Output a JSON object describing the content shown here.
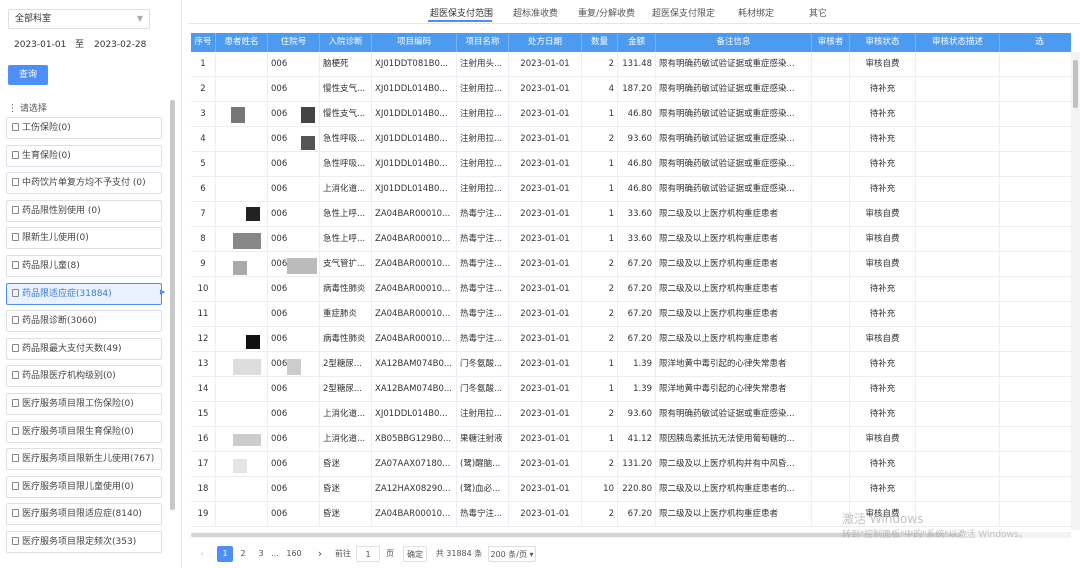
{
  "sidebar": {
    "department_select": "全部科室",
    "date_from": "2023-01-01",
    "date_sep": "至",
    "date_to": "2023-02-28",
    "query_label": "查询",
    "filter_title": "请选择",
    "filters": [
      {
        "label": "工伤保险(0)"
      },
      {
        "label": "生育保险(0)"
      },
      {
        "label": "中药饮片单复方均不予支付 (0)"
      },
      {
        "label": "药品限性别使用 (0)"
      },
      {
        "label": "限新生儿使用(0)"
      },
      {
        "label": "药品限儿童(8)"
      },
      {
        "label": "药品限适应症(31884)",
        "active": true
      },
      {
        "label": "药品限诊断(3060)"
      },
      {
        "label": "药品限最大支付天数(49)"
      },
      {
        "label": "药品限医疗机构级别(0)"
      },
      {
        "label": "医疗服务项目限工伤保险(0)"
      },
      {
        "label": "医疗服务项目限生育保险(0)"
      },
      {
        "label": "医疗服务项目限新生儿使用(767)"
      },
      {
        "label": "医疗服务项目限儿童使用(0)"
      },
      {
        "label": "医疗服务项目限适应症(8140)"
      },
      {
        "label": "医疗服务项目限定频次(353)"
      }
    ]
  },
  "tabs": [
    {
      "label": "超医保支付范围",
      "active": true
    },
    {
      "label": "超标准收费"
    },
    {
      "label": "重复/分解收费"
    },
    {
      "label": "超医保支付限定"
    },
    {
      "label": "耗材绑定"
    },
    {
      "label": "其它"
    }
  ],
  "table": {
    "headers": [
      "序号",
      "患者姓名",
      "住院号",
      "入院诊断",
      "项目编码",
      "项目名称",
      "处方日期",
      "数量",
      "金额",
      "备注信息",
      "审核者",
      "审核状态",
      "审核状态描述",
      "选"
    ],
    "rows": [
      {
        "no": "1",
        "zy": "006",
        "diag": "脑梗死",
        "code": "XJ01DDT081B0...",
        "name": "注射用头...",
        "date": "2023-01-01",
        "qty": "2",
        "amt": "131.48",
        "note": "限有明确药敏试验证据或重症感染...",
        "status": "审核自费"
      },
      {
        "no": "2",
        "zy": "006",
        "diag": "慢性支气...",
        "code": "XJ01DDL014B0...",
        "name": "注射用拉...",
        "date": "2023-01-01",
        "qty": "4",
        "amt": "187.20",
        "note": "限有明确药敏试验证据或重症感染...",
        "status": "待补充"
      },
      {
        "no": "3",
        "zy": "006",
        "diag": "慢性支气...",
        "code": "XJ01DDL014B0...",
        "name": "注射用拉...",
        "date": "2023-01-01",
        "qty": "1",
        "amt": "46.80",
        "note": "限有明确药敏试验证据或重症感染...",
        "status": "待补充"
      },
      {
        "no": "4",
        "zy": "006",
        "diag": "急性呼吸...",
        "code": "XJ01DDL014B0...",
        "name": "注射用拉...",
        "date": "2023-01-01",
        "qty": "2",
        "amt": "93.60",
        "note": "限有明确药敏试验证据或重症感染...",
        "status": "待补充"
      },
      {
        "no": "5",
        "zy": "006",
        "diag": "急性呼吸...",
        "code": "XJ01DDL014B0...",
        "name": "注射用拉...",
        "date": "2023-01-01",
        "qty": "1",
        "amt": "46.80",
        "note": "限有明确药敏试验证据或重症感染...",
        "status": "待补充"
      },
      {
        "no": "6",
        "zy": "006",
        "diag": "上消化道...",
        "code": "XJ01DDL014B0...",
        "name": "注射用拉...",
        "date": "2023-01-01",
        "qty": "1",
        "amt": "46.80",
        "note": "限有明确药敏试验证据或重症感染...",
        "status": "待补充"
      },
      {
        "no": "7",
        "zy": "006",
        "diag": "急性上呼...",
        "code": "ZA04BAR00010...",
        "name": "热毒宁注...",
        "date": "2023-01-01",
        "qty": "1",
        "amt": "33.60",
        "note": "限二级及以上医疗机构重症患者",
        "status": "审核自费"
      },
      {
        "no": "8",
        "zy": "006",
        "diag": "急性上呼...",
        "code": "ZA04BAR00010...",
        "name": "热毒宁注...",
        "date": "2023-01-01",
        "qty": "1",
        "amt": "33.60",
        "note": "限二级及以上医疗机构重症患者",
        "status": "审核自费"
      },
      {
        "no": "9",
        "zy": "006",
        "diag": "支气管扩...",
        "code": "ZA04BAR00010...",
        "name": "热毒宁注...",
        "date": "2023-01-01",
        "qty": "2",
        "amt": "67.20",
        "note": "限二级及以上医疗机构重症患者",
        "status": "审核自费"
      },
      {
        "no": "10",
        "zy": "006",
        "diag": "病毒性肺炎",
        "code": "ZA04BAR00010...",
        "name": "热毒宁注...",
        "date": "2023-01-01",
        "qty": "2",
        "amt": "67.20",
        "note": "限二级及以上医疗机构重症患者",
        "status": "待补充"
      },
      {
        "no": "11",
        "zy": "006",
        "diag": "重症肺炎",
        "code": "ZA04BAR00010...",
        "name": "热毒宁注...",
        "date": "2023-01-01",
        "qty": "2",
        "amt": "67.20",
        "note": "限二级及以上医疗机构重症患者",
        "status": "待补充"
      },
      {
        "no": "12",
        "zy": "006",
        "diag": "病毒性肺炎",
        "code": "ZA04BAR00010...",
        "name": "热毒宁注...",
        "date": "2023-01-01",
        "qty": "2",
        "amt": "67.20",
        "note": "限二级及以上医疗机构重症患者",
        "status": "审核自费"
      },
      {
        "no": "13",
        "zy": "006",
        "diag": "2型糖尿...",
        "code": "XA12BAM074B0...",
        "name": "门冬氨酸...",
        "date": "2023-01-01",
        "qty": "1",
        "amt": "1.39",
        "note": "限洋地黄中毒引起的心律失常患者",
        "status": "待补充"
      },
      {
        "no": "14",
        "zy": "006",
        "diag": "2型糖尿...",
        "code": "XA12BAM074B0...",
        "name": "门冬氨酸...",
        "date": "2023-01-01",
        "qty": "1",
        "amt": "1.39",
        "note": "限洋地黄中毒引起的心律失常患者",
        "status": "待补充"
      },
      {
        "no": "15",
        "zy": "006",
        "diag": "上消化道...",
        "code": "XJ01DDL014B0...",
        "name": "注射用拉...",
        "date": "2023-01-01",
        "qty": "2",
        "amt": "93.60",
        "note": "限有明确药敏试验证据或重症感染...",
        "status": "待补充"
      },
      {
        "no": "16",
        "zy": "006",
        "diag": "上消化道...",
        "code": "XB05BBG129B0...",
        "name": "果糖注射液",
        "date": "2023-01-01",
        "qty": "1",
        "amt": "41.12",
        "note": "限因胰岛素抵抗无法使用葡萄糖的...",
        "status": "审核自费"
      },
      {
        "no": "17",
        "zy": "006",
        "diag": "昏迷",
        "code": "ZA07AAX07180...",
        "name": "(鹭)醒脑...",
        "date": "2023-01-01",
        "qty": "2",
        "amt": "131.20",
        "note": "限二级及以上医疗机构并有中风昏...",
        "status": "待补充"
      },
      {
        "no": "18",
        "zy": "006",
        "diag": "昏迷",
        "code": "ZA12HAX08290...",
        "name": "(鹭)血必...",
        "date": "2023-01-01",
        "qty": "10",
        "amt": "220.80",
        "note": "限二级及以上医疗机构重症患者的...",
        "status": "待补充"
      },
      {
        "no": "19",
        "zy": "006",
        "diag": "昏迷",
        "code": "ZA04BAR00010...",
        "name": "热毒宁注...",
        "date": "2023-01-01",
        "qty": "2",
        "amt": "67.20",
        "note": "限二级及以上医疗机构重症患者",
        "status": "审核自费"
      }
    ]
  },
  "pager": {
    "prev": "‹",
    "p1": "1",
    "p2": "2",
    "p3": "3",
    "ellipsis": "...",
    "last": "160",
    "next": "›",
    "goto_label": "前往",
    "goto_value": "1",
    "page_unit": "页",
    "confirm": "确定",
    "total": "共 31884 条",
    "page_size": "200 条/页 ▾"
  },
  "watermark": {
    "line1": "激活 Windows",
    "line2": "转到\"控制面板\"中的\"系统\"以激活 Windows。"
  }
}
